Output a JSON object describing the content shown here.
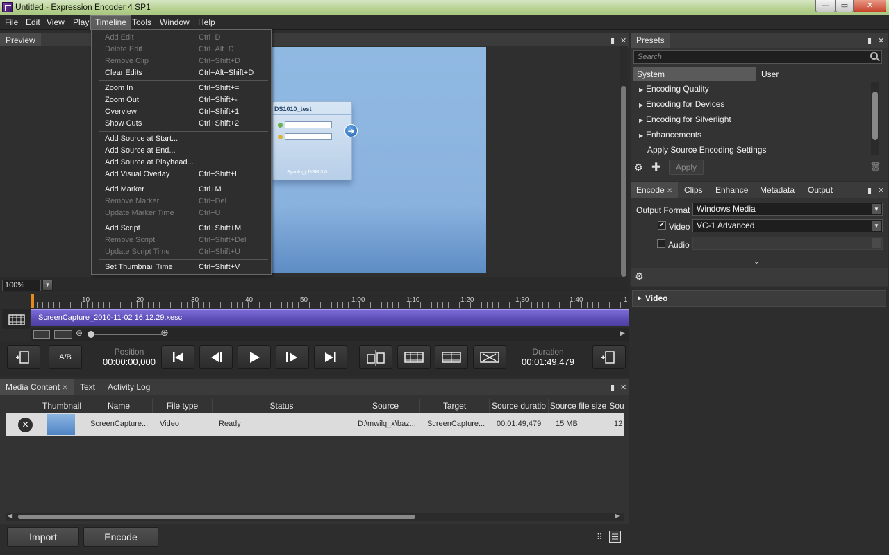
{
  "window": {
    "title": "Untitled - Expression Encoder 4 SP1",
    "min_label": "—",
    "max_label": "▭",
    "close_label": "✕"
  },
  "menubar": [
    {
      "label": "File"
    },
    {
      "label": "Edit"
    },
    {
      "label": "View"
    },
    {
      "label": "Play"
    },
    {
      "label": "Timeline"
    },
    {
      "label": "Tools"
    },
    {
      "label": "Window"
    },
    {
      "label": "Help"
    }
  ],
  "timeline_menu": [
    {
      "label": "Add Edit",
      "shortcut": "Ctrl+D",
      "enabled": false
    },
    {
      "label": "Delete Edit",
      "shortcut": "Ctrl+Alt+D",
      "enabled": false
    },
    {
      "label": "Remove Clip",
      "shortcut": "Ctrl+Shift+D",
      "enabled": false
    },
    {
      "label": "Clear Edits",
      "shortcut": "Ctrl+Alt+Shift+D",
      "enabled": true
    },
    {
      "label": "Zoom In",
      "shortcut": "Ctrl+Shift+=",
      "enabled": true
    },
    {
      "label": "Zoom Out",
      "shortcut": "Ctrl+Shift+-",
      "enabled": true
    },
    {
      "label": "Overview",
      "shortcut": "Ctrl+Shift+1",
      "enabled": true
    },
    {
      "label": "Show Cuts",
      "shortcut": "Ctrl+Shift+2",
      "enabled": true
    },
    {
      "label": "Add Source at Start...",
      "shortcut": "",
      "enabled": true
    },
    {
      "label": "Add Source at End...",
      "shortcut": "",
      "enabled": true
    },
    {
      "label": "Add Source at Playhead...",
      "shortcut": "",
      "enabled": true
    },
    {
      "label": "Add Visual Overlay",
      "shortcut": "Ctrl+Shift+L",
      "enabled": true
    },
    {
      "label": "Add Marker",
      "shortcut": "Ctrl+M",
      "enabled": true
    },
    {
      "label": "Remove Marker",
      "shortcut": "Ctrl+Del",
      "enabled": false
    },
    {
      "label": "Update Marker Time",
      "shortcut": "Ctrl+U",
      "enabled": false
    },
    {
      "label": "Add Script",
      "shortcut": "Ctrl+Shift+M",
      "enabled": true
    },
    {
      "label": "Remove Script",
      "shortcut": "Ctrl+Shift+Del",
      "enabled": false
    },
    {
      "label": "Update Script Time",
      "shortcut": "Ctrl+Shift+U",
      "enabled": false
    },
    {
      "label": "Set Thumbnail Time",
      "shortcut": "Ctrl+Shift+V",
      "enabled": true
    }
  ],
  "preview": {
    "tab": "Preview",
    "zoom": "100%",
    "login_title": "DS1010_test",
    "login_brand": "Synology DSM 3.0"
  },
  "timeline": {
    "ticks": [
      "10",
      "20",
      "30",
      "40",
      "50",
      "1:00",
      "1:10",
      "1:20",
      "1:30",
      "1:40",
      "1"
    ],
    "clip_name": "ScreenCapture_2010-11-02 16.12.29.xesc"
  },
  "transport": {
    "ab_label": "A/B",
    "position_label": "Position",
    "position_value": "00:00:00,000",
    "duration_label": "Duration",
    "duration_value": "00:01:49,479"
  },
  "media": {
    "tabs": [
      "Media Content",
      "Text",
      "Activity Log"
    ],
    "columns": [
      "Thumbnail",
      "Name",
      "File type",
      "Status",
      "Source",
      "Target",
      "Source duratio",
      "Source file size",
      "Sou"
    ],
    "rows": [
      {
        "name": "ScreenCapture...",
        "file_type": "Video",
        "status": "Ready",
        "source": "D:\\mwilq_x\\baz...",
        "target": "ScreenCapture...",
        "duration": "00:01:49,479",
        "size": "15 MB",
        "extra": "12"
      }
    ],
    "import_label": "Import",
    "encode_label": "Encode"
  },
  "presets": {
    "title": "Presets",
    "search_placeholder": "Search",
    "tab_system": "System",
    "tab_user": "User",
    "items": [
      {
        "label": "Encoding Quality",
        "expandable": true
      },
      {
        "label": "Encoding for Devices",
        "expandable": true
      },
      {
        "label": "Encoding for Silverlight",
        "expandable": true
      },
      {
        "label": "Enhancements",
        "expandable": true
      },
      {
        "label": "Apply Source Encoding Settings",
        "expandable": false
      }
    ],
    "apply_label": "Apply"
  },
  "encode": {
    "tabs": [
      "Encode",
      "Clips",
      "Enhance",
      "Metadata",
      "Output"
    ],
    "output_format_label": "Output Format",
    "output_format_value": "Windows Media",
    "video_label": "Video",
    "video_checked": true,
    "video_value": "VC-1 Advanced",
    "audio_label": "Audio",
    "audio_checked": false,
    "video_section": "Video"
  },
  "colors": {
    "accent": "#5b4cb4",
    "playhead": "#e58a1f",
    "titlebar": "#b6d18f"
  }
}
